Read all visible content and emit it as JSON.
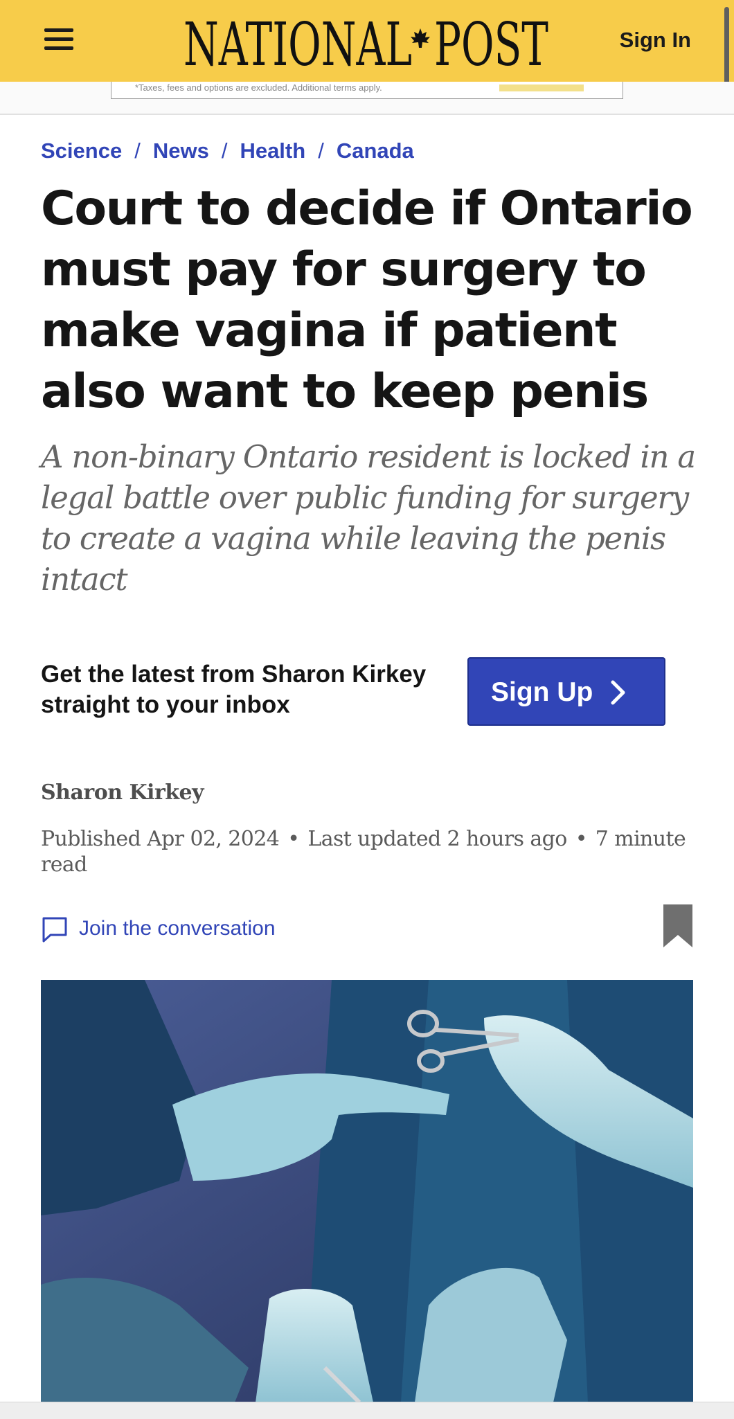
{
  "header": {
    "logo_left": "NATIONAL",
    "logo_right": "POST",
    "menu_icon": "hamburger-menu-icon",
    "sign_in_label": "Sign In",
    "background_color": "#f7cc4a"
  },
  "ad": {
    "text": "*Taxes, fees and options are excluded. Additional terms apply."
  },
  "breadcrumbs": [
    "Science",
    "News",
    "Health",
    "Canada"
  ],
  "article": {
    "headline": "Court to decide if Ontario must pay for surgery to make vagina if patient also want to keep penis",
    "subheadline": "A non-binary Ontario resident is locked in a legal battle over public funding for surgery to create a vagina while leaving the penis intact",
    "author": "Sharon Kirkey",
    "published": "Published Apr 02, 2024",
    "updated": "Last updated 2 hours ago",
    "read_time": "7 minute read",
    "conversation_label": "Join the conversation",
    "image_icon": "surgery-photo"
  },
  "newsletter": {
    "text": "Get the latest from Sharon Kirkey straight to your inbox",
    "button_label": "Sign Up"
  },
  "colors": {
    "link_blue": "#3145b7",
    "headline": "#151515",
    "subheadline": "#666666"
  }
}
